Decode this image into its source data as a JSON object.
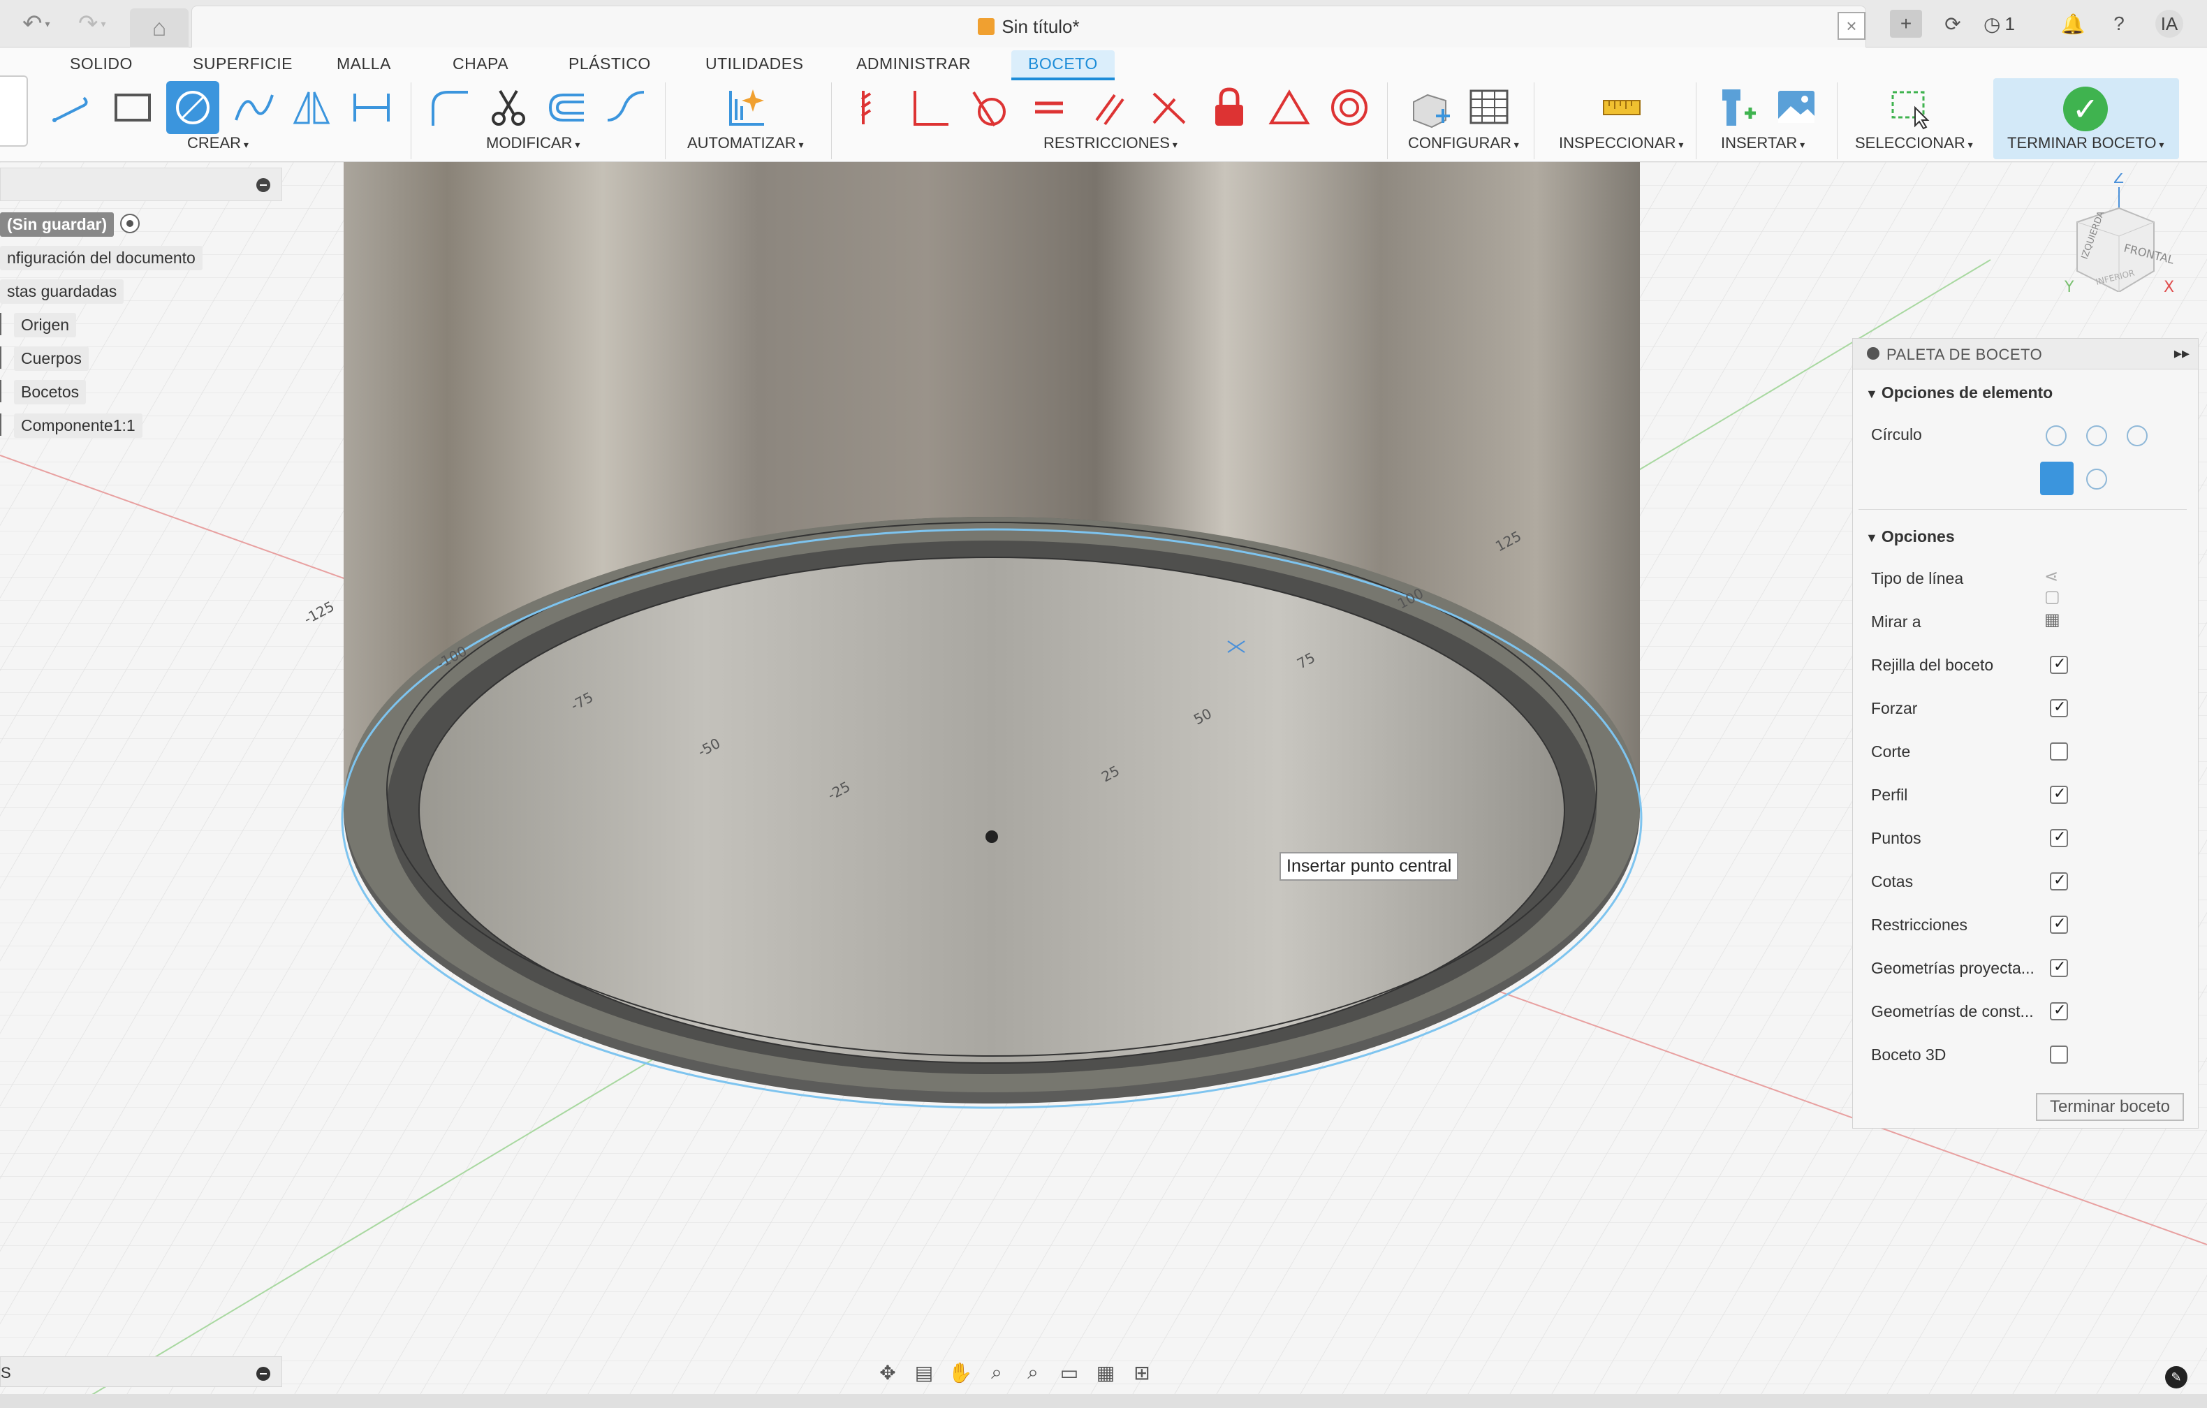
{
  "titlebar": {
    "document_title": "Sin título*",
    "job_count": "1",
    "user_initials": "IA"
  },
  "ribbon": {
    "tabs": [
      "SOLIDO",
      "SUPERFICIE",
      "MALLA",
      "CHAPA",
      "PLÁSTICO",
      "UTILIDADES",
      "ADMINISTRAR",
      "BOCETO"
    ],
    "active_tab": "BOCETO",
    "groups": {
      "create": "CREAR",
      "modify": "MODIFICAR",
      "automate": "AUTOMATIZAR",
      "constraints": "RESTRICCIONES",
      "configure": "CONFIGURAR",
      "inspect": "INSPECCIONAR",
      "insert": "INSERTAR",
      "select": "SELECCIONAR",
      "finish": "TERMINAR BOCETO"
    }
  },
  "browser": {
    "root": "(Sin guardar)",
    "items": [
      "nfiguración del documento",
      "stas guardadas",
      "Origen",
      "Cuerpos",
      "Bocetos",
      "Componente1:1"
    ]
  },
  "viewport": {
    "tooltip": "Insertar punto central",
    "axis_ticks": [
      "-125",
      "-100",
      "-75",
      "-50",
      "-25",
      "25",
      "50",
      "75",
      "100",
      "125"
    ],
    "viewcube": {
      "face_front": "FRONTAL",
      "face_left": "IZQUIERDA",
      "face_bottom": "INFERIOR",
      "axis_z": "Z",
      "axis_x": "X",
      "axis_y": "Y"
    }
  },
  "palette": {
    "title": "PALETA DE BOCETO",
    "element_options": {
      "heading": "Opciones de elemento",
      "circle_label": "Círculo"
    },
    "options": {
      "heading": "Opciones",
      "rows": [
        {
          "label": "Tipo de línea",
          "type": "icon"
        },
        {
          "label": "Mirar a",
          "type": "icon"
        },
        {
          "label": "Rejilla del boceto",
          "type": "check",
          "checked": true
        },
        {
          "label": "Forzar",
          "type": "check",
          "checked": true
        },
        {
          "label": "Corte",
          "type": "check",
          "checked": false
        },
        {
          "label": "Perfil",
          "type": "check",
          "checked": true
        },
        {
          "label": "Puntos",
          "type": "check",
          "checked": true
        },
        {
          "label": "Cotas",
          "type": "check",
          "checked": true
        },
        {
          "label": "Restricciones",
          "type": "check",
          "checked": true
        },
        {
          "label": "Geometrías proyecta...",
          "type": "check",
          "checked": true
        },
        {
          "label": "Geometrías de const...",
          "type": "check",
          "checked": true
        },
        {
          "label": "Boceto 3D",
          "type": "check",
          "checked": false
        }
      ]
    },
    "finish_button": "Terminar boceto"
  },
  "bottom_panel": {
    "label": "S"
  },
  "colors": {
    "accent": "#1c8cd8",
    "finish_green": "#3fb34f",
    "sketch_line": "#7ec4ef"
  }
}
